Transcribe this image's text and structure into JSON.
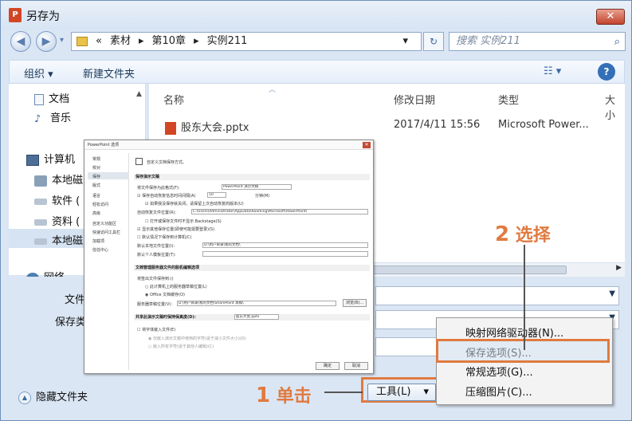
{
  "window": {
    "app_icon": "P",
    "title": "另存为",
    "close": "✕"
  },
  "nav": {
    "back_icon": "back-arrow-icon",
    "forward_icon": "forward-arrow-icon",
    "breadcrumb_prefix": "«",
    "breadcrumb": [
      "素材",
      "第10章",
      "实例211"
    ],
    "separator": "▸",
    "dropdown": "▾",
    "refresh": "↻",
    "search_placeholder": "搜索 实例211",
    "search_icon": "⌕"
  },
  "toolbar": {
    "organize": "组织 ▾",
    "new_folder": "新建文件夹",
    "view_icon": "☷ ▾",
    "help": "?"
  },
  "sidebar": {
    "items": [
      {
        "label": "文档",
        "icon": "document-icon"
      },
      {
        "label": "音乐",
        "icon": "music-icon"
      },
      {
        "label": "计算机",
        "icon": "computer-icon"
      },
      {
        "label": "本地磁",
        "icon": "drive-icon"
      },
      {
        "label": "软件 (",
        "icon": "drive-icon"
      },
      {
        "label": "资料 (",
        "icon": "drive-icon"
      },
      {
        "label": "本地磁",
        "icon": "drive-icon"
      },
      {
        "label": "网络",
        "icon": "network-icon"
      }
    ]
  },
  "filelist": {
    "columns": [
      "名称",
      "修改日期",
      "类型",
      "大小"
    ],
    "rows": [
      {
        "name": "股东大会.pptx",
        "date": "2017/4/11 15:56",
        "type": "Microsoft Power..."
      }
    ]
  },
  "form": {
    "filename_label": "文件",
    "savetype_label": "保存类",
    "hide_folders": "隐藏文件夹",
    "tools_button": "工具(L)",
    "tools_arrow": "▾"
  },
  "tools_menu": {
    "items": [
      "映射网络驱动器(N)...",
      "保存选项(S)...",
      "常规选项(G)...",
      "压缩图片(C)..."
    ]
  },
  "annotations": {
    "step1_num": "1",
    "step1_text": "单击",
    "step2_num": "2",
    "step2_text": "选择"
  },
  "ppt_options": {
    "title": "PowerPoint 选项",
    "sidebar": [
      "常规",
      "校对",
      "保存",
      "版式",
      "语言",
      "轻松访问",
      "高级",
      "自定义功能区",
      "快速访问工具栏",
      "加载项",
      "信任中心"
    ],
    "heading_line": "自定义文档保存方式。",
    "section_save": "保存演示文稿",
    "rows": [
      "将文件保存为此格式(F):",
      "保存自动恢复信息时间间隔(A)",
      "如果我没保存就关闭，请保留上次自动恢复的版本(U)",
      "自动恢复文件位置(R):",
      "打开或保存文件时不显示 Backstage(S)",
      "显示其他保存位置(即使可能需要登录)(S)",
      "默认情况下保存到计算机(C)",
      "默认本地文件位置(I):",
      "默认个人模板位置(T):"
    ],
    "format_value": "PowerPoint 演示文稿",
    "interval_value": "10",
    "interval_unit": "分钟(M)",
    "recover_path": "C:\\Users\\Administrator\\AppData\\Roaming\\Microsoft\\PowerPoint\\",
    "local_path": "D:\\用户目录\\我的文档\\",
    "section_offline": "文档管理服务器文件的脱机编辑选项",
    "offline_rows": [
      "将签出文件保存到:()",
      "此计算机上的服务器草稿位置(L)",
      "Office 文档缓存(O)",
      "服务器草稿位置(V):"
    ],
    "drafts_path": "D:\\用户目录\\我的文档\\SharePoint 草稿\\",
    "browse": "浏览(B)...",
    "section_fidelity": "共享此演示文稿时保持保真度(D):",
    "fidelity_value": "股东大会.pptx",
    "fidelity_rows": [
      "将字体嵌入文件(E)",
      "仅嵌入演示文稿中使用的字符(适于减小文件大小)(O)",
      "嵌入所有字符(适于其他人编辑)(C)"
    ],
    "ok": "确定",
    "cancel": "取消"
  },
  "colors": {
    "accent_orange": "#e07a40",
    "ppt_red": "#d24625"
  }
}
